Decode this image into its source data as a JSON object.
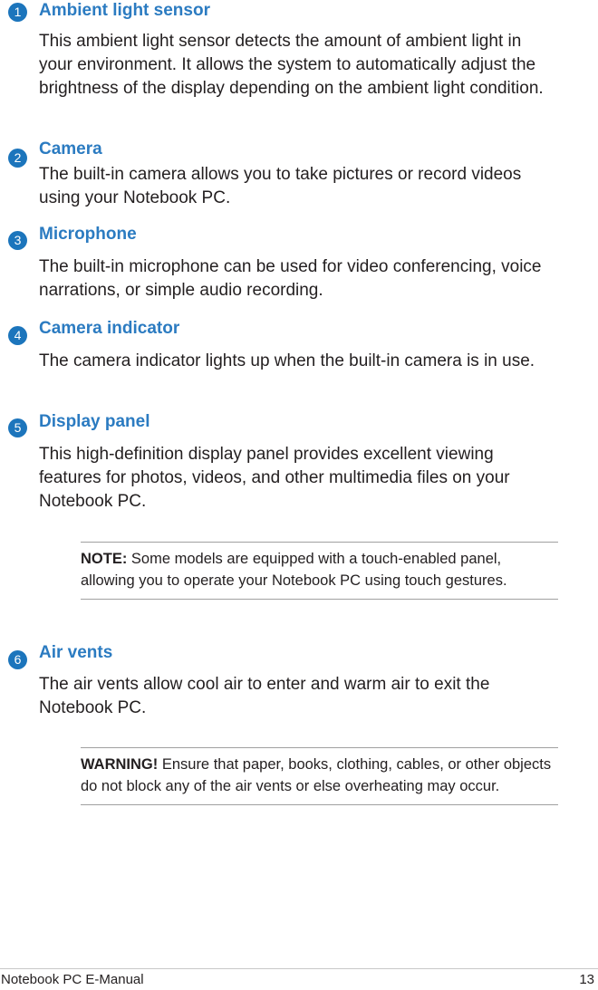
{
  "sections": [
    {
      "number": "1",
      "title": "Ambient light sensor",
      "text": "This ambient light sensor detects the amount of ambient light in your environment. It allows the system to automatically adjust the brightness of the display depending on the ambient light condition."
    },
    {
      "number": "2",
      "title": "Camera",
      "text": "The built-in camera allows you to take pictures or record videos using your Notebook PC."
    },
    {
      "number": "3",
      "title": "Microphone",
      "text": "The built-in microphone can be used for video conferencing, voice narrations, or simple audio recording."
    },
    {
      "number": "4",
      "title": "Camera indicator",
      "text": "The camera indicator lights up when the built-in camera is in use."
    },
    {
      "number": "5",
      "title": "Display panel",
      "text": "This high-definition display panel provides excellent viewing features for photos, videos, and other multimedia files on your Notebook PC."
    },
    {
      "number": "6",
      "title": "Air vents",
      "text": "The air vents allow cool air to enter and warm air to exit the Notebook PC."
    }
  ],
  "note": {
    "label": "NOTE:",
    "text": " Some models are equipped with a touch-enabled panel, allowing you to operate your Notebook PC using touch gestures."
  },
  "warning": {
    "label": "WARNING!",
    "text": " Ensure that paper, books, clothing, cables, or other objects do not block any of the air vents or else overheating may occur."
  },
  "footer": {
    "title": "Notebook PC E-Manual",
    "page": "13"
  },
  "colors": {
    "heading": "#2b7bc1",
    "badge": "#1c75bc"
  }
}
